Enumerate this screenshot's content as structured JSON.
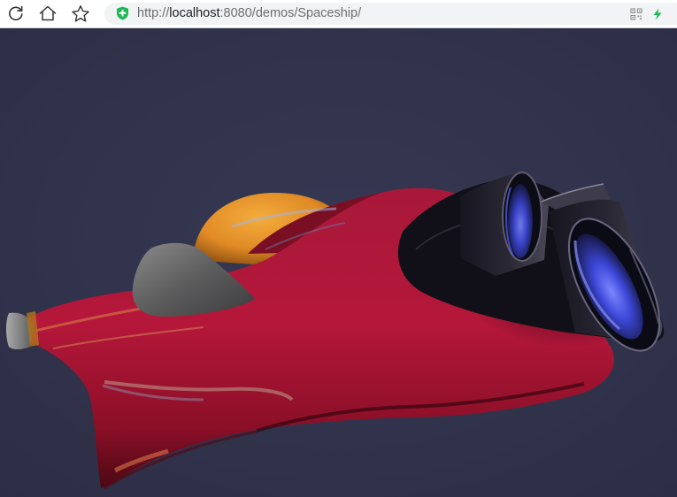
{
  "browser": {
    "url_scheme": "http://",
    "url_host": "localhost",
    "url_path": ":8080/demos/Spaceship/",
    "icons": {
      "reload": "reload-icon",
      "home": "home-icon",
      "bookmark": "star-icon",
      "secure": "shield-plus-icon",
      "qr": "qr-code-icon",
      "lightning": "lightning-icon"
    }
  },
  "scene": {
    "background_color": "#31324a",
    "hull_color": "#9c1530",
    "canopy_color": "#e7962a",
    "fin_color": "#6f6f70",
    "engine_glow_color": "#4c5aff"
  }
}
